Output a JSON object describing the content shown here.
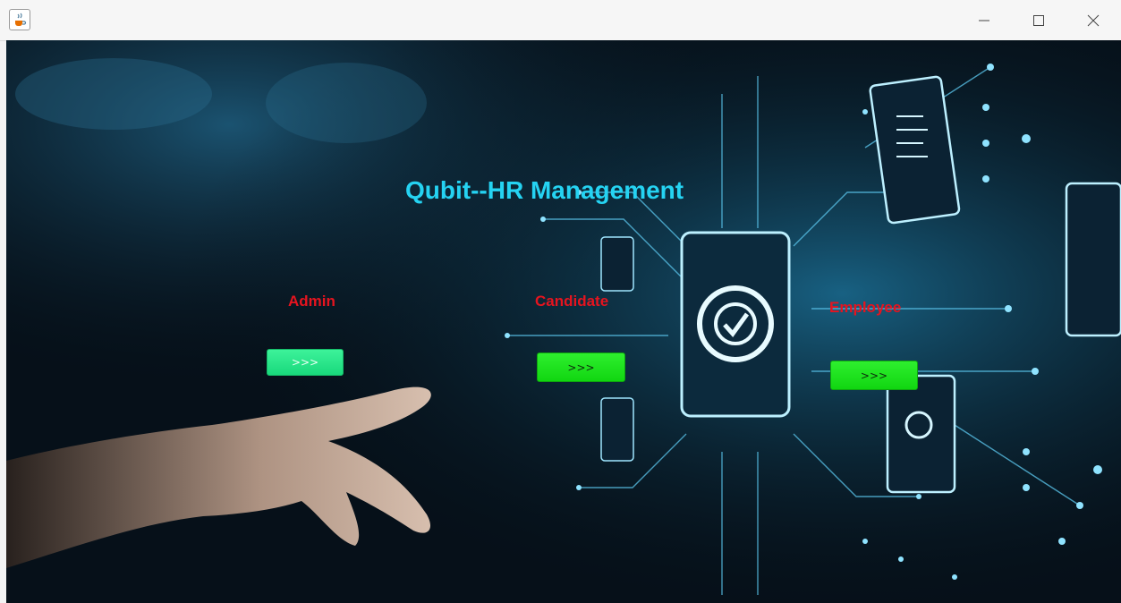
{
  "window": {
    "icon": "java-cup-icon",
    "controls": [
      "minimize-icon",
      "maximize-icon",
      "close-icon"
    ]
  },
  "app": {
    "title": "Qubit--HR Management"
  },
  "roles": [
    {
      "label": "Admin",
      "button": ">>>"
    },
    {
      "label": "Candidate",
      "button": ">>>"
    },
    {
      "label": "Employee",
      "button": ">>>"
    }
  ],
  "colors": {
    "title": "#25d3f2",
    "role_label": "#e5141f",
    "admin_button": "#2ce68c",
    "role_button": "#1fe31f"
  }
}
